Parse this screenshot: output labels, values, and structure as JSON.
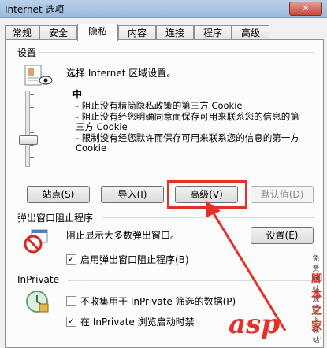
{
  "window": {
    "title": "Internet 选项"
  },
  "tabs": [
    {
      "label": "常规"
    },
    {
      "label": "安全"
    },
    {
      "label": "隐私"
    },
    {
      "label": "内容"
    },
    {
      "label": "连接"
    },
    {
      "label": "程序"
    },
    {
      "label": "高级"
    }
  ],
  "settings": {
    "group_title": "设置",
    "prompt": "选择 Internet 区域设置。",
    "level": "中",
    "desc_lines": [
      "- 阻止没有精简隐私政策的第三方 Cookie",
      "- 阻止没有经您明确同意而保存可用来联系您的信息的第",
      "三方 Cookie",
      "- 限制没有经您默许而保存可用来联系您的信息的第一方",
      "Cookie"
    ],
    "buttons": {
      "sites": "站点(S)",
      "import": "导入(I)",
      "advanced": "高级(V)",
      "default": "默认值(D)"
    }
  },
  "popup": {
    "group_title": "弹出窗口阻止程序",
    "text": "阻止显示大多数弹出窗口。",
    "settings_button": "设置(E)",
    "enable_label": "启用弹出窗口阻止程序(B)",
    "enable_checked": true
  },
  "inprivate": {
    "group_title": "InPrivate",
    "filter_label": "不收集用于 InPrivate 筛选的数据(P)",
    "filter_checked": false,
    "toolbar_label": "在 InPrivate 浏览启动时禁",
    "toolbar_checked": true
  },
  "watermark": {
    "main": "asp",
    "cn": "脚本之家",
    "sub": "免费网站源码下载站!"
  },
  "colors": {
    "annotation_red": "#e53027",
    "titlebar": "#a6c3e1"
  }
}
